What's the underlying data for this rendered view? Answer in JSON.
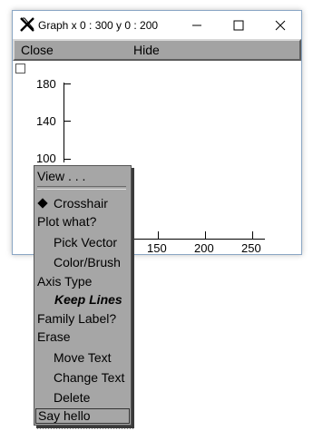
{
  "window": {
    "title": "Graph  x 0 : 300  y 0 : 200",
    "menubar": {
      "close_label": "Close",
      "hide_label": "Hide"
    }
  },
  "plot": {
    "y_ticks": [
      "180",
      "140",
      "100"
    ],
    "x_ticks": [
      "150",
      "200",
      "250"
    ]
  },
  "popup_menu": {
    "view": "View . . .",
    "crosshair": "Crosshair",
    "plot_what": "Plot what?",
    "pick_vector": "Pick Vector",
    "color_brush": "Color/Brush",
    "axis_type": "Axis Type",
    "keep_lines": "Keep Lines",
    "family_label": "Family Label?",
    "erase": "Erase",
    "move_text": "Move Text",
    "change_text": "Change Text",
    "delete": "Delete",
    "say_hello": "Say hello"
  },
  "colors": {
    "menubar_bg": "#a3a3a3",
    "popup_bg": "#a6a6a6"
  },
  "icons": {
    "app": "x-app-icon",
    "minimize": "minimize-icon",
    "maximize": "maximize-icon",
    "close": "close-icon",
    "selected_mark": "diamond-icon"
  }
}
